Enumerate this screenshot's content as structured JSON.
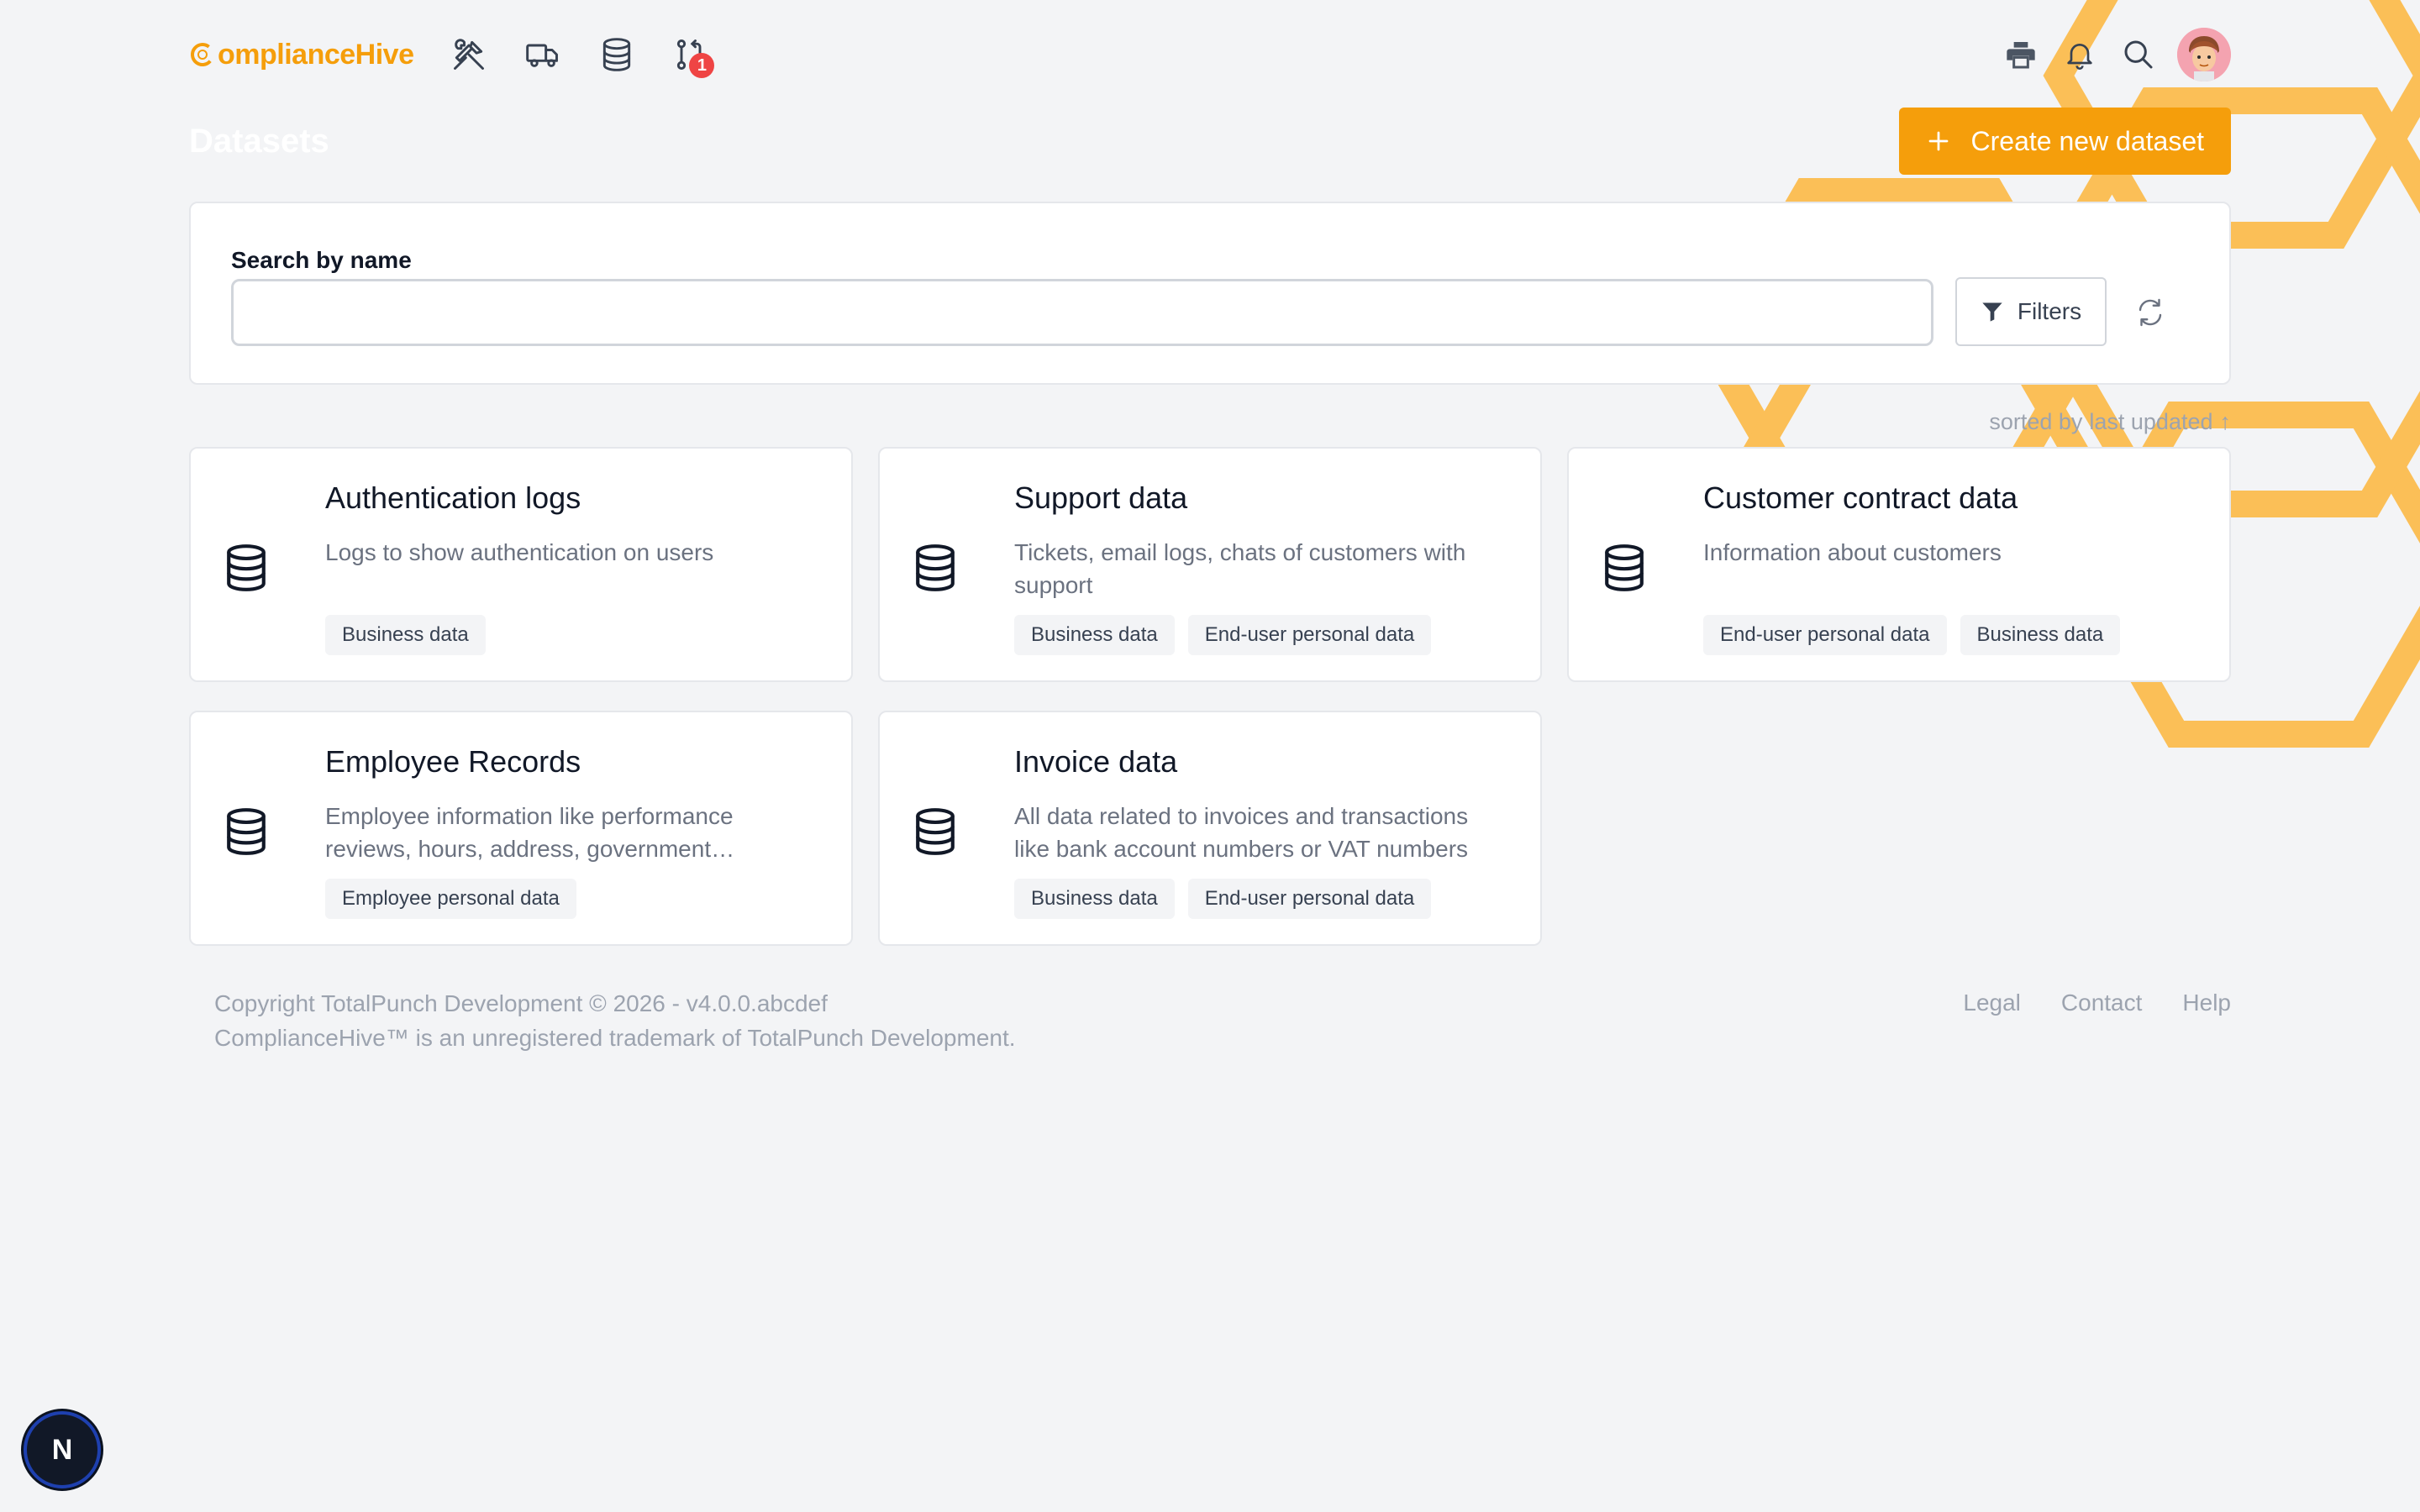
{
  "header": {
    "logo_text": "ComplianceHive",
    "logo_text_rest": "omplianceHive",
    "nav": [
      {
        "icon": "tools-icon",
        "label": "Tools"
      },
      {
        "icon": "truck-icon",
        "label": "Vendors"
      },
      {
        "icon": "database-icon",
        "label": "Datasets"
      },
      {
        "icon": "git-pull-request-icon",
        "label": "Requests",
        "badge": "1"
      }
    ],
    "right_icons": [
      "printer-icon",
      "bell-icon",
      "search-icon",
      "avatar"
    ]
  },
  "page": {
    "title": "Datasets",
    "create_button": "Create new dataset"
  },
  "search": {
    "label": "Search by name",
    "value": "",
    "placeholder": "",
    "filters_label": "Filters"
  },
  "sort": {
    "prefix": "sorted by",
    "field": "last updated",
    "direction": "↑"
  },
  "datasets": [
    {
      "title": "Authentication logs",
      "description": "Logs to show authentication on users",
      "tags": [
        "Business data"
      ]
    },
    {
      "title": "Support data",
      "description": "Tickets, email logs, chats of customers with support",
      "tags": [
        "Business data",
        "End-user personal data"
      ]
    },
    {
      "title": "Customer contract data",
      "description": "Information about customers",
      "tags": [
        "End-user personal data",
        "Business data"
      ]
    },
    {
      "title": "Employee Records",
      "description": "Employee information like performance reviews, hours, address, government…",
      "tags": [
        "Employee personal data"
      ]
    },
    {
      "title": "Invoice data",
      "description": "All data related to invoices and transactions like bank account numbers or VAT numbers",
      "tags": [
        "Business data",
        "End-user personal data"
      ]
    }
  ],
  "footer": {
    "copyright": "Copyright TotalPunch Development © 2026 - v4.0.0.abcdef",
    "trademark": "ComplianceHive™ is an unregistered trademark of TotalPunch Development.",
    "links": [
      "Legal",
      "Contact",
      "Help"
    ]
  },
  "dev_indicator": "N",
  "colors": {
    "accent": "#f59e0b",
    "hex_pattern": "#fbbf57",
    "badge": "#ef4444"
  }
}
